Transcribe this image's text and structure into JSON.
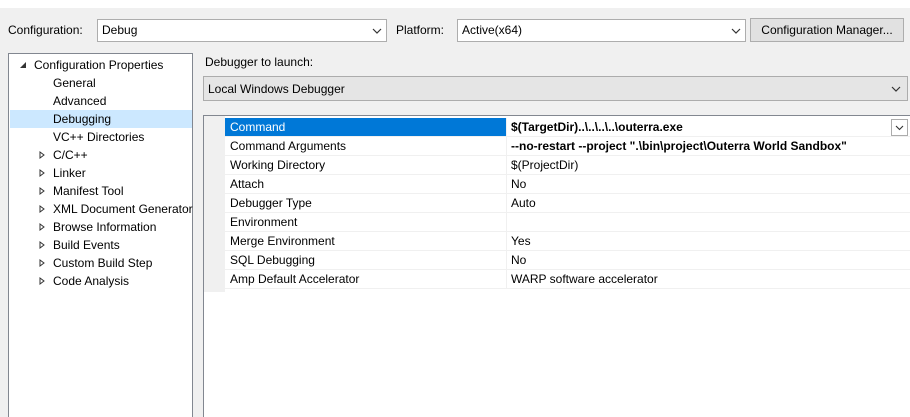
{
  "config": {
    "configuration_label": "Configuration:",
    "configuration_value": "Debug",
    "platform_label": "Platform:",
    "platform_value": "Active(x64)",
    "config_manager_button": "Configuration Manager..."
  },
  "tree": {
    "items": [
      {
        "label": "Configuration Properties",
        "level": 0,
        "expander": "expanded"
      },
      {
        "label": "General",
        "level": 1,
        "expander": "none"
      },
      {
        "label": "Advanced",
        "level": 1,
        "expander": "none"
      },
      {
        "label": "Debugging",
        "level": 1,
        "expander": "none",
        "selected": true
      },
      {
        "label": "VC++ Directories",
        "level": 1,
        "expander": "none"
      },
      {
        "label": "C/C++",
        "level": 1,
        "expander": "collapsed"
      },
      {
        "label": "Linker",
        "level": 1,
        "expander": "collapsed"
      },
      {
        "label": "Manifest Tool",
        "level": 1,
        "expander": "collapsed"
      },
      {
        "label": "XML Document Generator",
        "level": 1,
        "expander": "collapsed"
      },
      {
        "label": "Browse Information",
        "level": 1,
        "expander": "collapsed"
      },
      {
        "label": "Build Events",
        "level": 1,
        "expander": "collapsed"
      },
      {
        "label": "Custom Build Step",
        "level": 1,
        "expander": "collapsed"
      },
      {
        "label": "Code Analysis",
        "level": 1,
        "expander": "collapsed"
      }
    ]
  },
  "debugger": {
    "launch_label": "Debugger to launch:",
    "launch_value": "Local Windows Debugger"
  },
  "properties": [
    {
      "name": "Command",
      "value": "$(TargetDir)..\\..\\..\\..\\outerra.exe",
      "bold": true,
      "selected": true
    },
    {
      "name": "Command Arguments",
      "value": " --no-restart --project \".\\bin\\project\\Outerra World Sandbox\"",
      "bold": true
    },
    {
      "name": "Working Directory",
      "value": "$(ProjectDir)"
    },
    {
      "name": "Attach",
      "value": "No"
    },
    {
      "name": "Debugger Type",
      "value": "Auto"
    },
    {
      "name": "Environment",
      "value": ""
    },
    {
      "name": "Merge Environment",
      "value": "Yes"
    },
    {
      "name": "SQL Debugging",
      "value": "No"
    },
    {
      "name": "Amp Default Accelerator",
      "value": "WARP software accelerator"
    }
  ],
  "colors": {
    "selection": "#0078d7",
    "tree_selection": "#cce8ff"
  }
}
